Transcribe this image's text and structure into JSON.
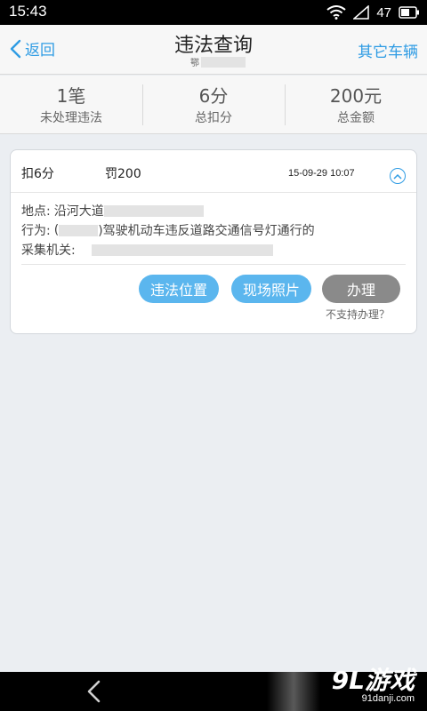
{
  "status": {
    "time": "15:43",
    "battery": "47"
  },
  "header": {
    "back_label": "返回",
    "title": "违法查询",
    "plate_prefix": "鄂",
    "other_label": "其它车辆"
  },
  "summary": [
    {
      "value": "1笔",
      "label": "未处理违法"
    },
    {
      "value": "6分",
      "label": "总扣分"
    },
    {
      "value": "200元",
      "label": "总金额"
    }
  ],
  "record": {
    "points": "扣6分",
    "fine": "罚200",
    "date": "15-09-29 10:07",
    "location_label": "地点:",
    "location_value": "沿河大道",
    "behavior_label": "行为:",
    "behavior_open": "(",
    "behavior_text": ")驾驶机动车违反道路交通信号灯通行的",
    "agency_label": "采集机关:",
    "btn_location": "违法位置",
    "btn_photo": "现场照片",
    "btn_handle": "办理",
    "cannot_handle": "不支持办理？"
  },
  "watermark": {
    "main": "9L游戏",
    "sub": "91danji.com"
  }
}
